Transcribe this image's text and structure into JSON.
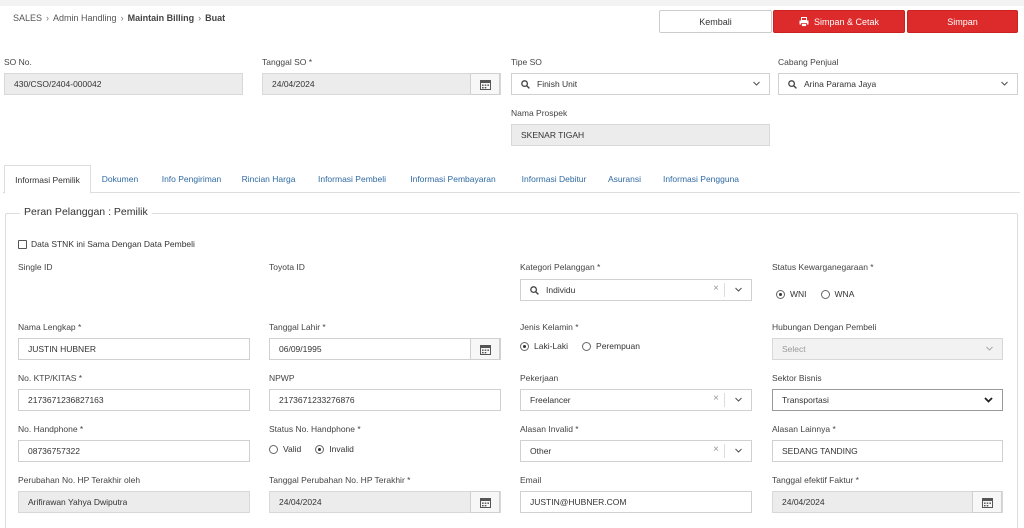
{
  "breadcrumb": {
    "sales": "SALES",
    "admin": "Admin Handling",
    "billing": "Maintain Billing",
    "current": "Buat"
  },
  "buttons": {
    "kembali": "Kembali",
    "cetak": "Simpan & Cetak",
    "simpan": "Simpan"
  },
  "header": {
    "so_no_label": "SO No.",
    "so_no_value": "430/CSO/2404-000042",
    "tanggal_so_label": "Tanggal SO *",
    "tanggal_so_value": "24/04/2024",
    "tipe_so_label": "Tipe SO",
    "tipe_so_value": "Finish Unit",
    "cabang_label": "Cabang Penjual",
    "cabang_value": "Arina Parama Jaya",
    "prospek_label": "Nama Prospek",
    "prospek_value": "SKENAR TIGAH"
  },
  "tabs": [
    "Informasi Pemilik",
    "Dokumen",
    "Info Pengiriman",
    "Rincian Harga",
    "Informasi Pembeli",
    "Informasi Pembayaran",
    "Informasi Debitur",
    "Asuransi",
    "Informasi Pengguna"
  ],
  "form": {
    "legend": "Peran Pelanggan : Pemilik",
    "stnk_checkbox": "Data STNK ini Sama Dengan Data Pembeli",
    "single_id_label": "Single ID",
    "toyota_id_label": "Toyota ID",
    "kategori_label": "Kategori Pelanggan *",
    "kategori_value": "Individu",
    "kewarganegaraan_label": "Status Kewarganegaraan *",
    "wni": "WNI",
    "wna": "WNA",
    "nama_label": "Nama Lengkap *",
    "nama_value": "JUSTIN HUBNER",
    "tgl_lahir_label": "Tanggal Lahir *",
    "tgl_lahir_value": "06/09/1995",
    "jk_label": "Jenis Kelamin *",
    "laki": "Laki-Laki",
    "perempuan": "Perempuan",
    "hubungan_label": "Hubungan Dengan Pembeli",
    "hubungan_placeholder": "Select",
    "ktp_label": "No. KTP/KITAS *",
    "ktp_value": "2173671236827163",
    "npwp_label": "NPWP",
    "npwp_value": "2173671233276876",
    "pekerjaan_label": "Pekerjaan",
    "pekerjaan_value": "Freelancer",
    "sektor_label": "Sektor Bisnis",
    "sektor_value": "Transportasi",
    "hp_label": "No. Handphone *",
    "hp_value": "08736757322",
    "status_hp_label": "Status No. Handphone *",
    "valid": "Valid",
    "invalid": "Invalid",
    "alasan_label": "Alasan Invalid *",
    "alasan_value": "Other",
    "alasan_lain_label": "Alasan Lainnya *",
    "alasan_lain_value": "SEDANG TANDING",
    "perubahan_oleh_label": "Perubahan No. HP Terakhir oleh",
    "perubahan_oleh_value": "Arifirawan Yahya Dwiputra",
    "tgl_perubahan_label": "Tanggal Perubahan No. HP Terakhir *",
    "tgl_perubahan_value": "24/04/2024",
    "email_label": "Email",
    "email_value": "JUSTIN@HUBNER.COM",
    "tgl_faktur_label": "Tanggal efektif Faktur *",
    "tgl_faktur_value": "24/04/2024"
  }
}
